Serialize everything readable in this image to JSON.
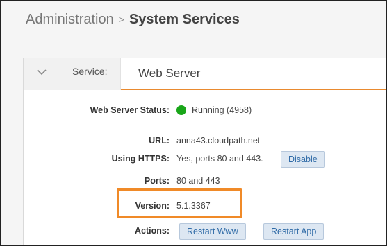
{
  "breadcrumb": {
    "parent": "Administration",
    "separator": ">",
    "current": "System Services"
  },
  "service": {
    "label": "Service:",
    "name": "Web Server"
  },
  "details": {
    "status_label": "Web Server Status:",
    "status_value": "Running (4958)",
    "status_color": "#19a619",
    "url_label": "URL:",
    "url_value": "anna43.cloudpath.net",
    "https_label": "Using HTTPS:",
    "https_value": "Yes, ports 80 and 443.",
    "https_button": "Disable",
    "ports_label": "Ports:",
    "ports_value": "80 and 443",
    "version_label": "Version:",
    "version_value": "5.1.3367",
    "actions_label": "Actions:",
    "restart_www": "Restart Www",
    "restart_app": "Restart App"
  },
  "colors": {
    "accent": "#e98a2f",
    "highlight": "#f08a28",
    "button_bg": "#dde7f2",
    "button_text": "#2e6aa6"
  },
  "icons": {
    "collapse": "chevron-down-icon",
    "status": "status-dot-icon"
  }
}
